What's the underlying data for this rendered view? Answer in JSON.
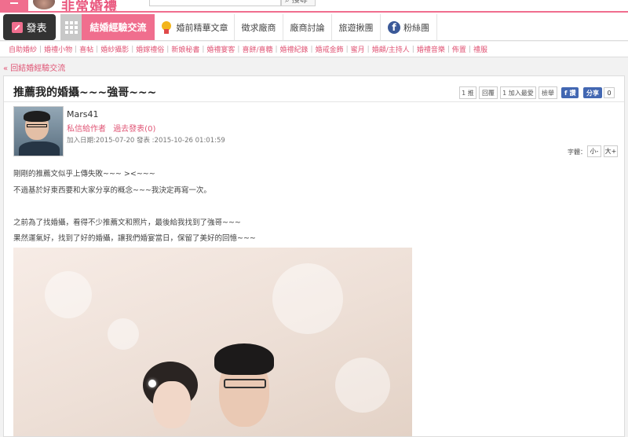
{
  "header": {
    "site_name": "非常婚禮",
    "search_button": "搜尋"
  },
  "nav": {
    "post_label": "發表",
    "active_label": "結婚經驗交流",
    "items": [
      "婚前精華文章",
      "徵求廠商",
      "廠商討論",
      "旅遊揪團",
      "粉絲團"
    ]
  },
  "categories": [
    "自助婚紗",
    "婚禮小物",
    "喜帖",
    "婚紗攝影",
    "婚嫁禮俗",
    "新娘秘書",
    "婚禮宴客",
    "喜餅/喜糖",
    "婚禮紀錄",
    "婚戒金飾",
    "蜜月",
    "婚顧/主持人",
    "婚禮音樂",
    "佈置",
    "禮服"
  ],
  "back_link": "« 回結婚經驗交流",
  "post": {
    "title": "推薦我的婚攝~~~強哥~~~",
    "actions": {
      "like": "1 推",
      "reply": "回覆",
      "favorite": "1 加入最愛",
      "report": "檢舉",
      "fb_like": "讚",
      "share": "分享",
      "share_count": "0"
    },
    "author": {
      "name": "Mars41",
      "private_message": "私信給作者",
      "past_posts": "過去發表(0)",
      "dates": "加入日期:2015-07-20 發表 :2015-10-26 01:01:59"
    },
    "font_size": {
      "label": "字體：",
      "smaller": "小-",
      "larger": "大+"
    },
    "paragraphs": [
      "剛剛的推薦文似乎上傳失敗~~~ ><~~~",
      "不過基於好東西要和大家分享的概念~~~我決定再寫一次。",
      "之前為了找婚攝，看得不少推薦文和照片，最後給我找到了強哥~~~",
      "果然運氣好，找到了好的婚攝，讓我們婚宴當日，保留了美好的回憶~~~"
    ]
  },
  "colors": {
    "brand_pink": "#f06e8e",
    "link_pink": "#e05575",
    "facebook_blue": "#3b5998"
  },
  "icons": [
    "menu-icon",
    "pencil-icon",
    "grid-icon",
    "medal-icon",
    "facebook-icon"
  ]
}
